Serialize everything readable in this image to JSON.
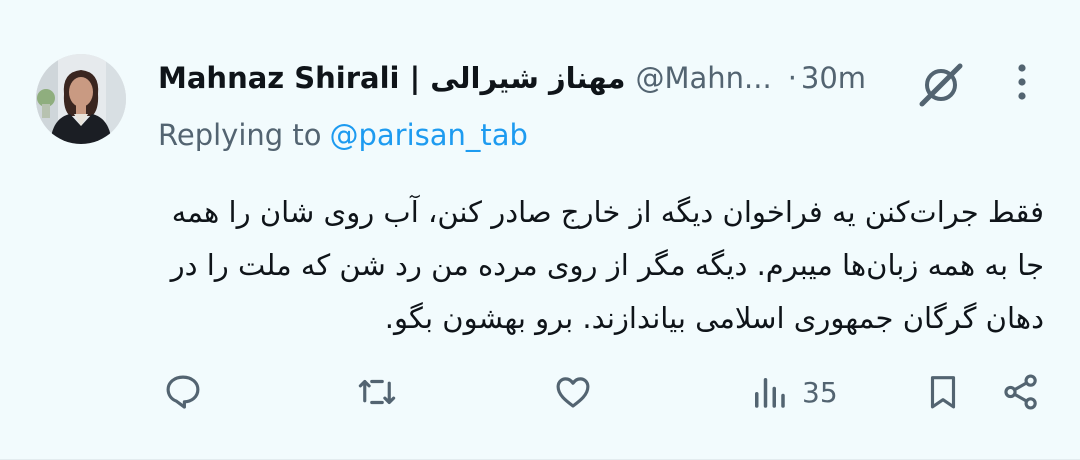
{
  "tweet": {
    "display_name": "Mahnaz Shirali | مهناز شیرالی",
    "handle": "@Mahn...",
    "separator": "·",
    "time": "30m",
    "reply_prefix": "Replying to",
    "reply_handle": "@parisan_tab",
    "text": "فقط جرات‌کنن یه فراخوان دیگه از خارج صادر کنن، آب روی شان را همه جا به همه زبان‌ها میبرم. دیگه مگر از روی مرده من رد شن که ملت را در دهان گرگان جمهوری اسلامی بیاندازند. برو بهشون بگو."
  },
  "actions": {
    "reply_icon": "reply-icon",
    "retweet_icon": "retweet-icon",
    "like_icon": "heart-icon",
    "views_icon": "views-icon",
    "views_count": "35",
    "bookmark_icon": "bookmark-icon",
    "share_icon": "share-icon"
  },
  "colors": {
    "background": "#f2fbfd",
    "text": "#0f1419",
    "secondary": "#536471",
    "link": "#1d9bf0"
  }
}
